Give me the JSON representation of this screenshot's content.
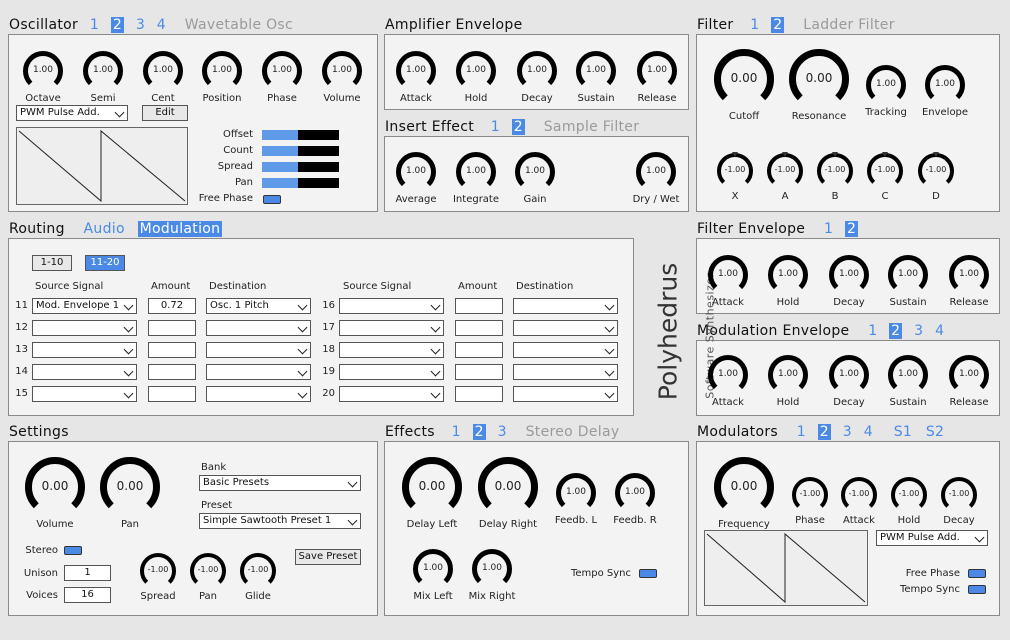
{
  "oscillator": {
    "title": "Oscillator",
    "tabs": [
      "1",
      "2",
      "3",
      "4"
    ],
    "selected": "2",
    "subtitle": "Wavetable Osc",
    "knobs": [
      {
        "value": "1.00",
        "label": "Octave"
      },
      {
        "value": "1.00",
        "label": "Semi"
      },
      {
        "value": "1.00",
        "label": "Cent"
      },
      {
        "value": "1.00",
        "label": "Position"
      },
      {
        "value": "1.00",
        "label": "Phase"
      },
      {
        "value": "1.00",
        "label": "Volume"
      }
    ],
    "waveform": "PWM Pulse Add.",
    "edit_label": "Edit",
    "params": [
      {
        "label": "Offset",
        "value": 0.47
      },
      {
        "label": "Count",
        "value": 0.47
      },
      {
        "label": "Spread",
        "value": 0.47
      },
      {
        "label": "Pan",
        "value": 0.47
      }
    ],
    "free_phase": "Free Phase"
  },
  "amp_env": {
    "title": "Amplifier Envelope",
    "knobs": [
      {
        "value": "1.00",
        "label": "Attack"
      },
      {
        "value": "1.00",
        "label": "Hold"
      },
      {
        "value": "1.00",
        "label": "Decay"
      },
      {
        "value": "1.00",
        "label": "Sustain"
      },
      {
        "value": "1.00",
        "label": "Release"
      }
    ]
  },
  "insert": {
    "title": "Insert Effect",
    "tabs": [
      "1",
      "2"
    ],
    "selected": "2",
    "subtitle": "Sample Filter",
    "knobs": [
      {
        "value": "1.00",
        "label": "Average"
      },
      {
        "value": "1.00",
        "label": "Integrate"
      },
      {
        "value": "1.00",
        "label": "Gain"
      },
      {
        "value": "1.00",
        "label": "Dry / Wet"
      }
    ]
  },
  "filter": {
    "title": "Filter",
    "tabs": [
      "1",
      "2"
    ],
    "selected": "2",
    "subtitle": "Ladder Filter",
    "big": [
      {
        "value": "0.00",
        "label": "Cutoff"
      },
      {
        "value": "0.00",
        "label": "Resonance"
      }
    ],
    "small": [
      {
        "value": "1.00",
        "label": "Tracking"
      },
      {
        "value": "1.00",
        "label": "Envelope"
      }
    ],
    "mod": [
      {
        "value": "-1.00",
        "label": "X"
      },
      {
        "value": "-1.00",
        "label": "A"
      },
      {
        "value": "-1.00",
        "label": "B"
      },
      {
        "value": "-1.00",
        "label": "C"
      },
      {
        "value": "-1.00",
        "label": "D"
      }
    ]
  },
  "routing": {
    "title": "Routing",
    "tabs": [
      "Audio",
      "Modulation"
    ],
    "selected": "Modulation",
    "pages": [
      "1-10",
      "11-20"
    ],
    "page_selected": "11-20",
    "headers": {
      "source": "Source Signal",
      "amount": "Amount",
      "destination": "Destination"
    },
    "left": [
      {
        "n": "11",
        "src": "Mod. Envelope 1",
        "amt": "0.72",
        "dst": "Osc. 1 Pitch"
      },
      {
        "n": "12",
        "src": "",
        "amt": "",
        "dst": ""
      },
      {
        "n": "13",
        "src": "",
        "amt": "",
        "dst": ""
      },
      {
        "n": "14",
        "src": "",
        "amt": "",
        "dst": ""
      },
      {
        "n": "15",
        "src": "",
        "amt": "",
        "dst": ""
      }
    ],
    "right": [
      {
        "n": "16",
        "src": "",
        "amt": "",
        "dst": ""
      },
      {
        "n": "17",
        "src": "",
        "amt": "",
        "dst": ""
      },
      {
        "n": "18",
        "src": "",
        "amt": "",
        "dst": ""
      },
      {
        "n": "19",
        "src": "",
        "amt": "",
        "dst": ""
      },
      {
        "n": "20",
        "src": "",
        "amt": "",
        "dst": ""
      }
    ]
  },
  "brand": {
    "name": "Polyhedrus",
    "tagline": "Software Synthesizer"
  },
  "filter_env": {
    "title": "Filter Envelope",
    "tabs": [
      "1",
      "2"
    ],
    "selected": "2",
    "knobs": [
      {
        "value": "1.00",
        "label": "Attack"
      },
      {
        "value": "1.00",
        "label": "Hold"
      },
      {
        "value": "1.00",
        "label": "Decay"
      },
      {
        "value": "1.00",
        "label": "Sustain"
      },
      {
        "value": "1.00",
        "label": "Release"
      }
    ]
  },
  "mod_env": {
    "title": "Modulation Envelope",
    "tabs": [
      "1",
      "2",
      "3",
      "4"
    ],
    "selected": "2",
    "knobs": [
      {
        "value": "1.00",
        "label": "Attack"
      },
      {
        "value": "1.00",
        "label": "Hold"
      },
      {
        "value": "1.00",
        "label": "Decay"
      },
      {
        "value": "1.00",
        "label": "Sustain"
      },
      {
        "value": "1.00",
        "label": "Release"
      }
    ]
  },
  "settings": {
    "title": "Settings",
    "big": [
      {
        "value": "0.00",
        "label": "Volume"
      },
      {
        "value": "0.00",
        "label": "Pan"
      }
    ],
    "bank_label": "Bank",
    "bank": "Basic Presets",
    "preset_label": "Preset",
    "preset": "Simple Sawtooth Preset 1",
    "save_label": "Save Preset",
    "stereo": "Stereo",
    "unison_label": "Unison",
    "unison": "1",
    "voices_label": "Voices",
    "voices": "16",
    "small": [
      {
        "value": "-1.00",
        "label": "Spread"
      },
      {
        "value": "-1.00",
        "label": "Pan"
      },
      {
        "value": "-1.00",
        "label": "Glide"
      }
    ]
  },
  "effects": {
    "title": "Effects",
    "tabs": [
      "1",
      "2",
      "3"
    ],
    "selected": "2",
    "subtitle": "Stereo Delay",
    "big": [
      {
        "value": "0.00",
        "label": "Delay Left"
      },
      {
        "value": "0.00",
        "label": "Delay Right"
      }
    ],
    "small": [
      {
        "value": "1.00",
        "label": "Feedb. L"
      },
      {
        "value": "1.00",
        "label": "Feedb. R"
      },
      {
        "value": "1.00",
        "label": "Mix Left"
      },
      {
        "value": "1.00",
        "label": "Mix Right"
      }
    ],
    "tempo_sync": "Tempo Sync"
  },
  "modulators": {
    "title": "Modulators",
    "tabs": [
      "1",
      "2",
      "3",
      "4"
    ],
    "selected": "2",
    "extra": [
      "S1",
      "S2"
    ],
    "big": {
      "value": "0.00",
      "label": "Frequency"
    },
    "small": [
      {
        "value": "-1.00",
        "label": "Phase"
      },
      {
        "value": "-1.00",
        "label": "Attack"
      },
      {
        "value": "-1.00",
        "label": "Hold"
      },
      {
        "value": "-1.00",
        "label": "Decay"
      }
    ],
    "waveform": "PWM Pulse Add.",
    "free_phase": "Free Phase",
    "tempo_sync": "Tempo Sync"
  }
}
